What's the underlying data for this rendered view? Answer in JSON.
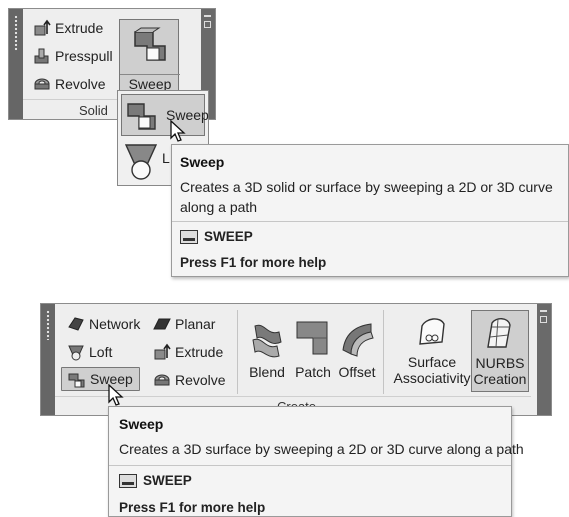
{
  "top_panel": {
    "items": [
      "Extrude",
      "Presspull",
      "Revolve"
    ],
    "sweep_button_label": "Sweep",
    "panel_label": "Solid",
    "dropdown": {
      "sweep_label": "Sweep",
      "loft_label_partial": "L"
    }
  },
  "top_tooltip": {
    "title": "Sweep",
    "description": "Creates a 3D solid or surface by sweeping a 2D or 3D curve along a path",
    "command": "SWEEP",
    "help": "Press F1 for more help"
  },
  "bottom_panel": {
    "col1": [
      "Network",
      "Loft",
      "Sweep"
    ],
    "col2": [
      "Planar",
      "Extrude",
      "Revolve"
    ],
    "big_buttons": [
      "Blend",
      "Patch",
      "Offset"
    ],
    "surface_associativity": [
      "Surface",
      "Associativity"
    ],
    "nurbs_creation": [
      "NURBS",
      "Creation"
    ],
    "panel_label": "Create"
  },
  "bottom_tooltip": {
    "title": "Sweep",
    "description": "Creates a 3D surface by sweeping a 2D or 3D curve along a path",
    "command": "SWEEP",
    "help": "Press F1 for more help"
  },
  "colors": {
    "grip": "#666666",
    "panel_bg": "#eeeeee",
    "selected_bg": "#cfcfcf",
    "tooltip_bg": "#f4f4f4"
  }
}
